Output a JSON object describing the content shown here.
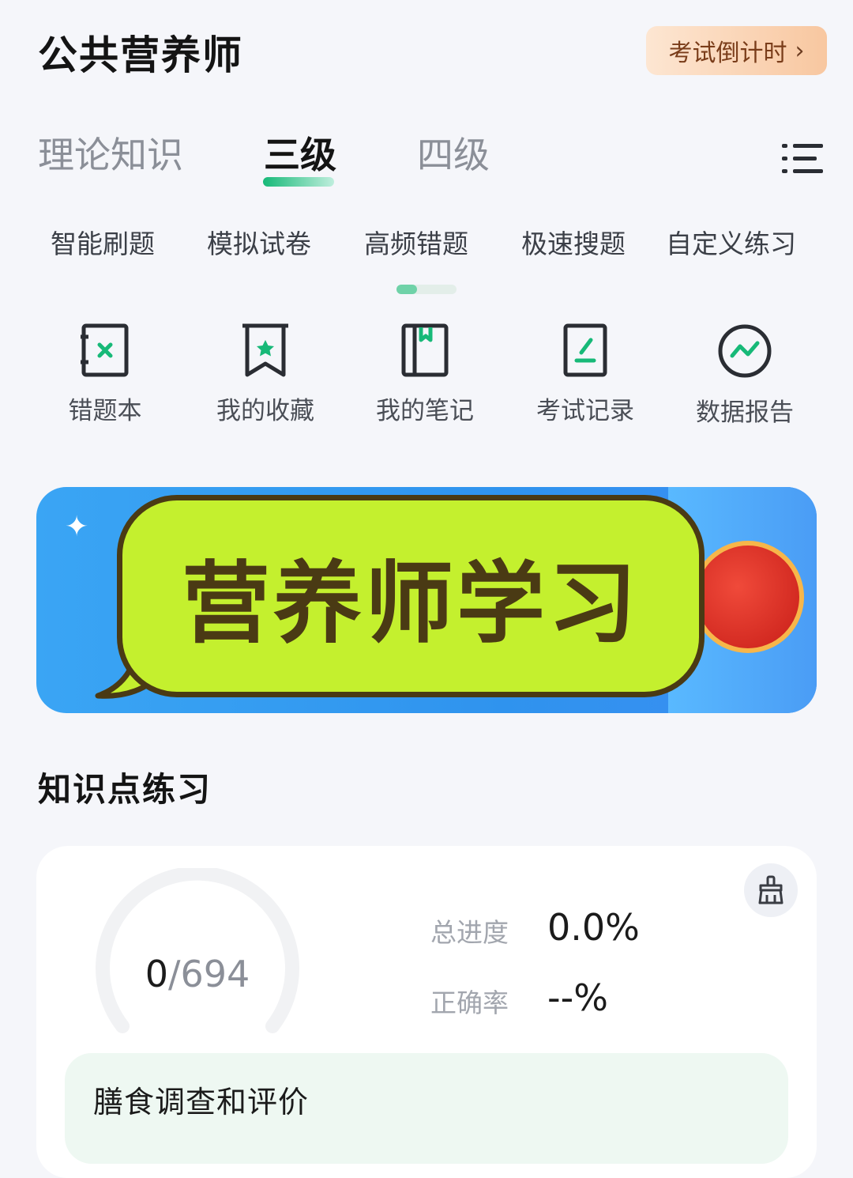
{
  "header": {
    "title": "公共营养师",
    "countdown_label": "考试倒计时",
    "countdown_chevron": "›"
  },
  "level_tabs": {
    "items": [
      {
        "label": "理论知识",
        "selected": false
      },
      {
        "label": "三级",
        "selected": true
      },
      {
        "label": "四级",
        "selected": false
      }
    ],
    "menu_icon": "list-menu-icon"
  },
  "practice_modes": {
    "items": [
      "智能刷题",
      "模拟试卷",
      "高频错题",
      "极速搜题",
      "自定义练习"
    ],
    "scroll_position": 0.33
  },
  "tools": {
    "items": [
      {
        "label": "错题本",
        "icon": "wrong-book-icon"
      },
      {
        "label": "我的收藏",
        "icon": "bookmark-star-icon"
      },
      {
        "label": "我的笔记",
        "icon": "notebook-icon"
      },
      {
        "label": "考试记录",
        "icon": "exam-record-icon"
      },
      {
        "label": "数据报告",
        "icon": "data-report-icon"
      }
    ]
  },
  "banner": {
    "overlay_text": "营养师学习",
    "sparkle": "✦"
  },
  "knowledge_practice": {
    "title": "知识点练习",
    "done": "0",
    "total": "694",
    "progress_label": "总进度",
    "progress_value": "0.0%",
    "accuracy_label": "正确率",
    "accuracy_value": "--%",
    "chapter_title": "膳食调查和评价"
  },
  "colors": {
    "accent": "#17b978",
    "background": "#f5f6fa",
    "bubble": "#c4f02e",
    "banner": "#2f93ee"
  }
}
